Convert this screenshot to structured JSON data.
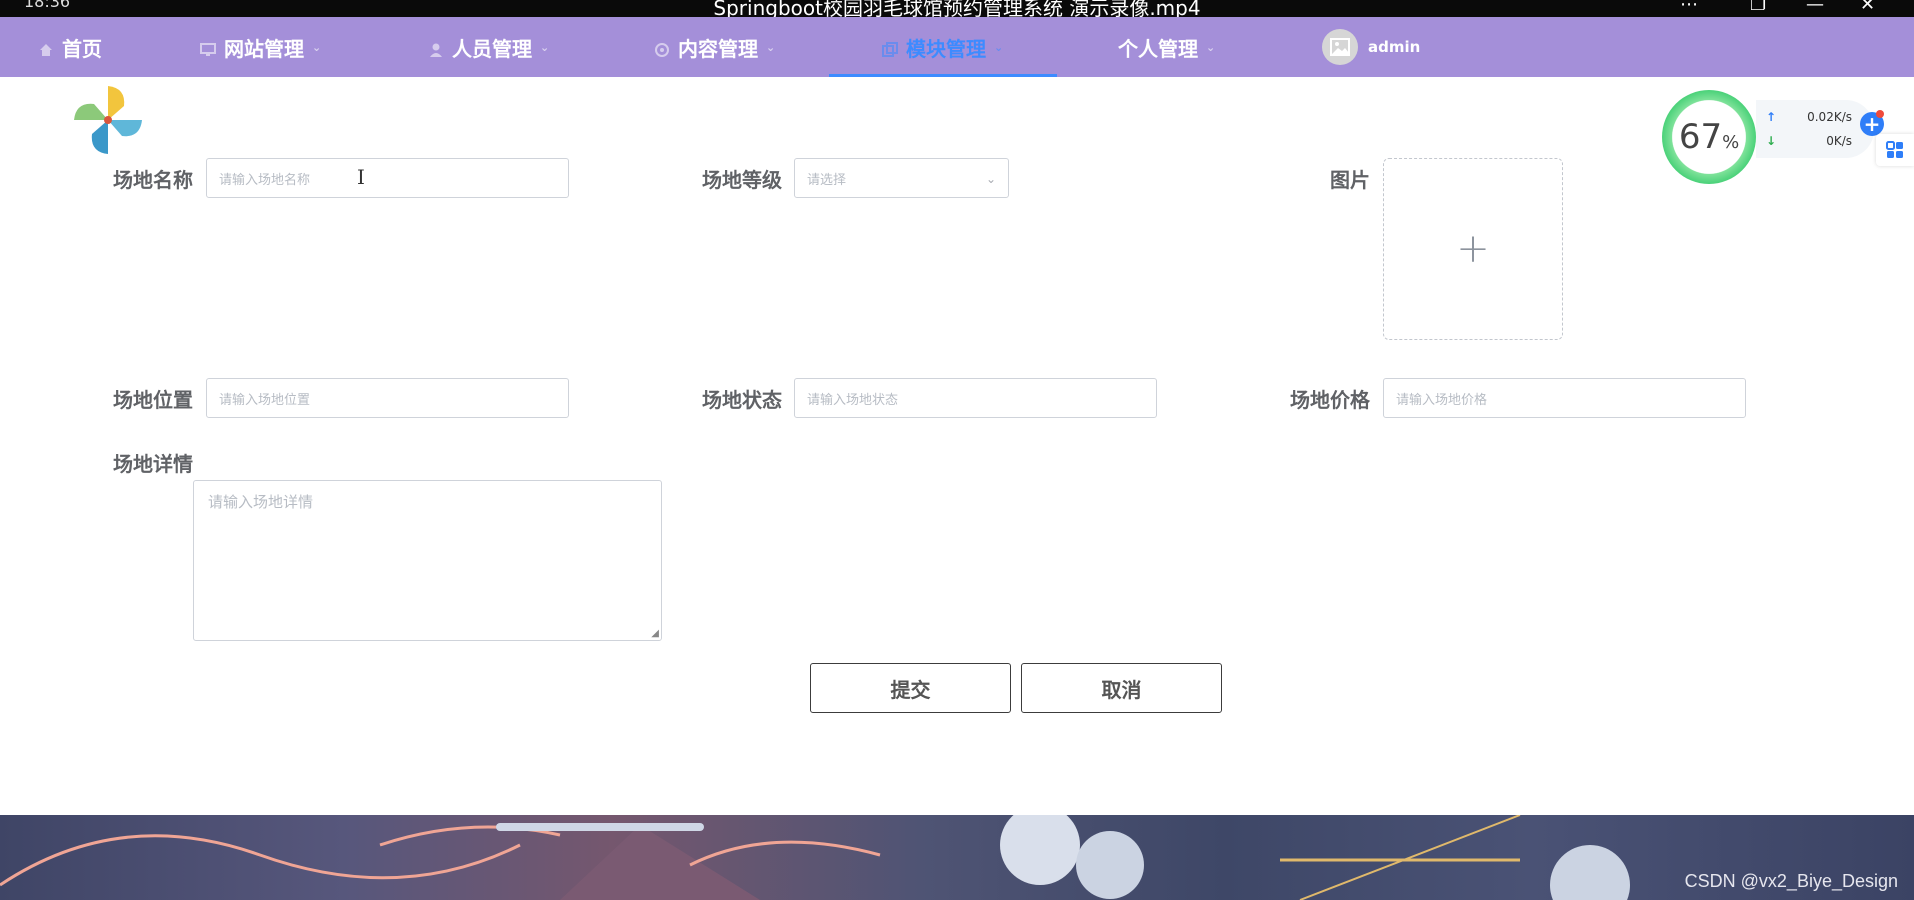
{
  "window": {
    "time": "18:36",
    "title": "Springboot校园羽毛球馆预约管理系统 演示录像.mp4",
    "controls": [
      "⋯",
      "❐",
      "—",
      "✕"
    ]
  },
  "nav": {
    "items": [
      {
        "label": "首页",
        "icon": "home-icon"
      },
      {
        "label": "网站管理",
        "icon": "monitor-icon"
      },
      {
        "label": "人员管理",
        "icon": "person-icon"
      },
      {
        "label": "内容管理",
        "icon": "circle-icon"
      },
      {
        "label": "模块管理",
        "icon": "copy-icon"
      },
      {
        "label": "个人管理",
        "icon": "none"
      }
    ],
    "active_index": 4,
    "accent": "#3d8bff",
    "bg": "#a48fd9",
    "user": "admin"
  },
  "form": {
    "name_label": "场地名称",
    "name_placeholder": "请输入场地名称",
    "level_label": "场地等级",
    "level_placeholder": "请选择",
    "image_label": "图片",
    "upload_symbol": "+",
    "location_label": "场地位置",
    "location_placeholder": "请输入场地位置",
    "status_label": "场地状态",
    "status_placeholder": "请输入场地状态",
    "price_label": "场地价格",
    "price_placeholder": "请输入场地价格",
    "detail_label": "场地详情",
    "detail_placeholder": "请输入场地详情",
    "submit": "提交",
    "cancel": "取消"
  },
  "widget": {
    "percent": "67",
    "percent_sign": "%",
    "up_arrow": "↑",
    "up_speed": "0.02K/s",
    "down_arrow": "↓",
    "down_speed": "0K/s",
    "plus": "+"
  },
  "watermark": "CSDN @vx2_Biye_Design"
}
